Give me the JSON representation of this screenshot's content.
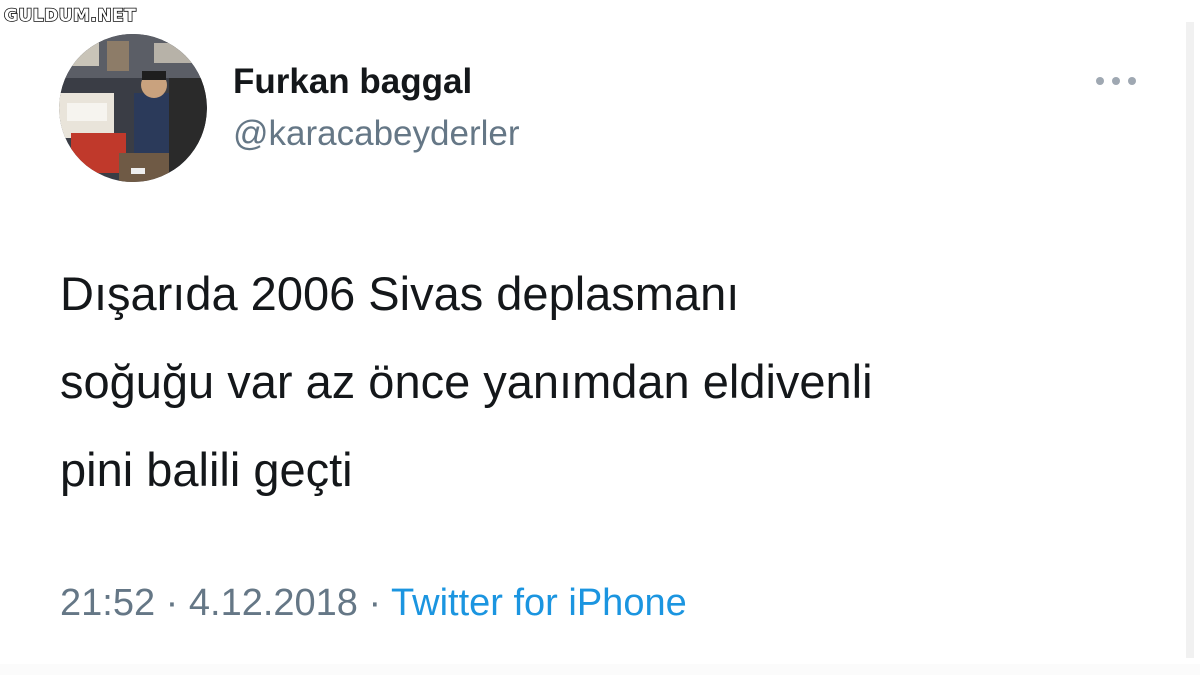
{
  "watermark": {
    "text": "GULDUM.NET"
  },
  "tweet": {
    "author": {
      "display_name": "Furkan baggal",
      "handle": "@karacabeyderler",
      "avatar_icon": "profile-photo"
    },
    "more_icon": "ellipsis-icon",
    "text_lines": [
      "Dışarıda 2006 Sivas deplasmanı",
      "soğuğu var az önce yanımdan eldivenli",
      "pini balili geçti"
    ],
    "meta": {
      "time": "21:52",
      "separator_1": " · ",
      "date": "4.12.2018",
      "separator_2": " · ",
      "source": "Twitter for iPhone"
    }
  },
  "colors": {
    "text": "#14171a",
    "secondary": "#657786",
    "link": "#1b95e0",
    "background": "#ffffff"
  }
}
